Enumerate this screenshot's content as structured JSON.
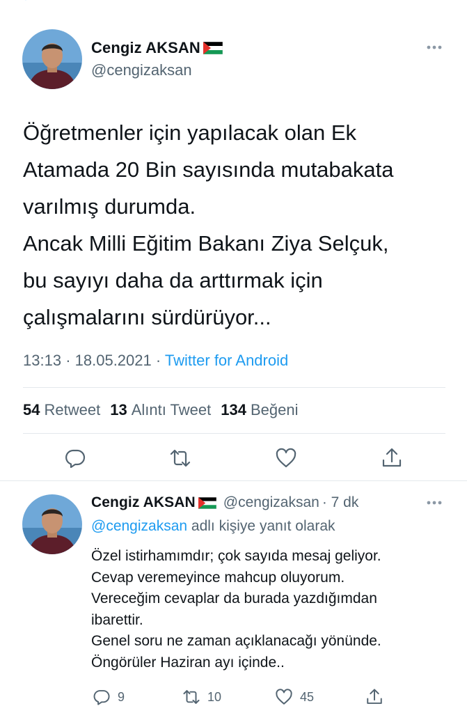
{
  "main_tweet": {
    "author": {
      "display_name": "Cengiz AKSAN",
      "flag_icon": "palestine-flag-icon",
      "handle": "@cengizaksan"
    },
    "text_lines": [
      "Öğretmenler için yapılacak olan Ek",
      "Atamada 20 Bin sayısında mutabakata",
      "varılmış durumda.",
      "Ancak Milli Eğitim Bakanı Ziya Selçuk,",
      "bu sayıyı daha da arttırmak için",
      "çalışmalarını sürdürüyor..."
    ],
    "time": "13:13",
    "date": "18.05.2021",
    "separator": "·",
    "source": "Twitter for Android",
    "stats": {
      "retweets": {
        "count": "54",
        "label": "Retweet"
      },
      "quotes": {
        "count": "13",
        "label": "Alıntı Tweet"
      },
      "likes": {
        "count": "134",
        "label": "Beğeni"
      }
    },
    "actions": [
      "reply-icon",
      "retweet-icon",
      "like-icon",
      "share-icon"
    ]
  },
  "reply_tweet": {
    "author": {
      "display_name": "Cengiz AKSAN",
      "flag_icon": "palestine-flag-icon",
      "handle": "@cengizaksan",
      "time_ago": "· 7 dk"
    },
    "replying_to": {
      "mention": "@cengizaksan",
      "suffix": "adlı kişiye yanıt olarak"
    },
    "text_lines": [
      "Özel istirhamımdır; çok sayıda mesaj geliyor.",
      "Cevap veremeyince mahcup oluyorum.",
      "Vereceğim cevaplar da burada yazdığımdan",
      "ibarettir.",
      "Genel soru ne zaman açıklanacağı yönünde.",
      "Öngörüler Haziran ayı içinde.."
    ],
    "counts": {
      "replies": "9",
      "retweets": "10",
      "likes": "45"
    }
  },
  "colors": {
    "text": "#0f1419",
    "secondary": "#536471",
    "link": "#1d9bf0",
    "divider": "#e3e8ec"
  }
}
